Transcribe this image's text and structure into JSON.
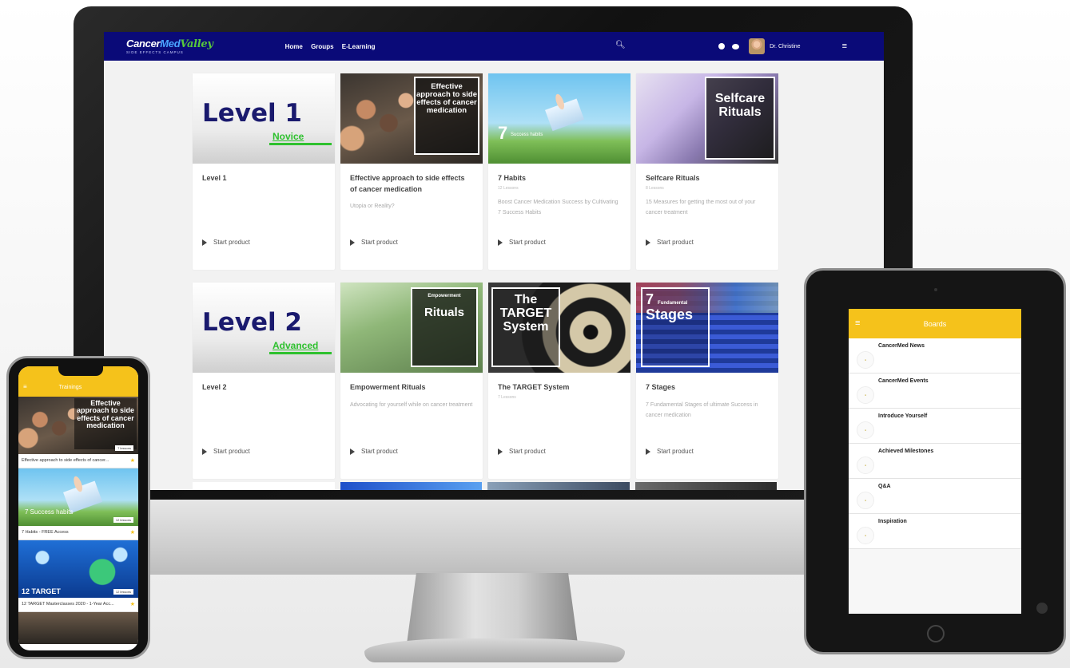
{
  "desktop": {
    "logo": {
      "part1": "Cancer",
      "part2": "Med",
      "part3": "Valley",
      "subtitle": "SIDE EFFECTS CAMPUS"
    },
    "nav": [
      "Home",
      "Groups",
      "E-Learning"
    ],
    "user_name": "Dr. Christine",
    "icons": {
      "search": "search-icon",
      "notifications": "bell-icon",
      "messages": "chat-icon",
      "menu": "hamburger-menu-icon"
    },
    "cards": [
      {
        "title": "Level 1",
        "meta": "",
        "desc": "",
        "start": "Start product",
        "thumb_title": "Level 1",
        "thumb_sub": "Novice"
      },
      {
        "title": "Effective approach to side effects of cancer medication",
        "meta": "",
        "desc": "Utopia or Reality?",
        "start": "Start product",
        "thumb_text": "Effective approach to side effects of cancer medication"
      },
      {
        "title": "7 Habits",
        "meta": "12 Lessons",
        "desc": "Boost Cancer Medication Success by Cultivating 7 Success Habits",
        "start": "Start product",
        "thumb_big": "7",
        "thumb_sub": "Success habits"
      },
      {
        "title": "Selfcare Rituals",
        "meta": "8 Lessons",
        "desc": "15 Measures for getting the most out of your cancer treatment",
        "start": "Start product",
        "thumb_text": "Selfcare Rituals"
      },
      {
        "title": "Level 2",
        "meta": "",
        "desc": "",
        "start": "Start product",
        "thumb_title": "Level 2",
        "thumb_sub": "Advanced"
      },
      {
        "title": "Empowerment Rituals",
        "meta": "",
        "desc": "Advocating for yourself while on cancer treatment",
        "start": "Start product",
        "thumb_top": "Empowerment",
        "thumb_text": "Rituals"
      },
      {
        "title": "The TARGET System",
        "meta": "7 Lessons",
        "desc": "",
        "start": "Start product",
        "thumb_text": "The TARGET System"
      },
      {
        "title": "7 Stages",
        "meta": "",
        "desc": "7 Fundamental Stages of ultimate Success in cancer medication",
        "start": "Start product",
        "thumb_big": "7",
        "thumb_small": "Fundamental",
        "thumb_text": "Stages"
      }
    ]
  },
  "phone": {
    "header": "Trainings",
    "items": [
      {
        "caption": "Effective approach to side effects of cancer...",
        "tag": "7 lessons",
        "thumb_text": "Effective approach to side effects of cancer medication"
      },
      {
        "caption": "7 Habits - FREE Access",
        "tag": "12 lessons",
        "thumb_text": "7 Success habits"
      },
      {
        "caption": "12 TARGET Masterclasses 2020 - 1-Year Acc...",
        "tag": "12 lessons",
        "thumb_text": "12 TARGET"
      }
    ]
  },
  "tablet": {
    "header": "Boards",
    "boards": [
      {
        "label": "CancerMed News"
      },
      {
        "label": "CancerMed Events"
      },
      {
        "label": "Introduce Yourself"
      },
      {
        "label": "Achieved Milestones"
      },
      {
        "label": "Q&A"
      },
      {
        "label": "Inspiration"
      }
    ]
  },
  "colors": {
    "topbar": "#0a0a78",
    "accent_yellow": "#f5c21b",
    "level_blue": "#1a1a6e",
    "level_green": "#2ec12e"
  }
}
